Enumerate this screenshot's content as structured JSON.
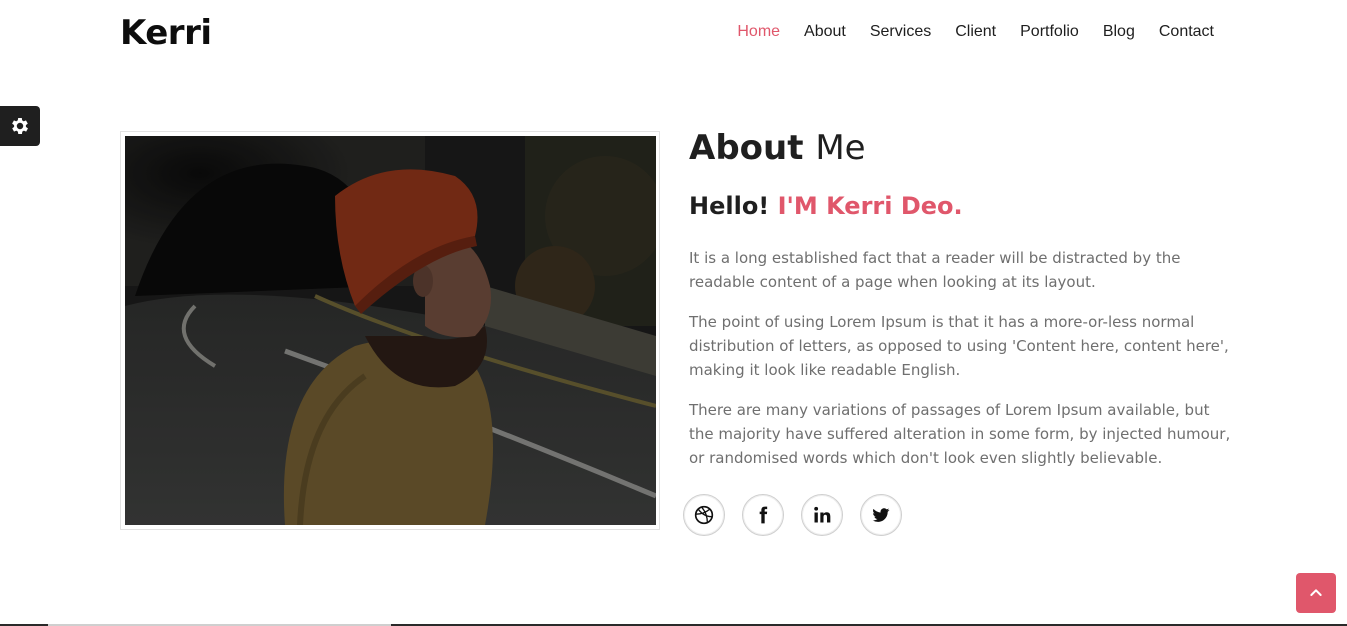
{
  "header": {
    "logo": "Kerri",
    "nav": [
      {
        "label": "Home",
        "active": true
      },
      {
        "label": "About",
        "active": false
      },
      {
        "label": "Services",
        "active": false
      },
      {
        "label": "Client",
        "active": false
      },
      {
        "label": "Portfolio",
        "active": false
      },
      {
        "label": "Blog",
        "active": false
      },
      {
        "label": "Contact",
        "active": false
      }
    ]
  },
  "about": {
    "title_bold": "About",
    "title_light": "Me",
    "greeting": "Hello!",
    "name": "I'M Kerri Deo.",
    "paragraphs": [
      "It is a long established fact that a reader will be distracted by the readable content of a page when looking at its layout.",
      "The point of using Lorem Ipsum is that it has a more-or-less normal distribution of letters, as opposed to using 'Content here, content here', making it look like readable English.",
      "There are many variations of passages of Lorem Ipsum available, but the majority have suffered alteration in some form, by injected humour, or randomised words which don't look even slightly believable."
    ]
  },
  "social": [
    "dribbble-icon",
    "facebook-icon",
    "linkedin-icon",
    "twitter-icon"
  ],
  "colors": {
    "accent": "#e0576b",
    "text_dark": "#1f1f1f",
    "text_muted": "#6f6f6f"
  }
}
